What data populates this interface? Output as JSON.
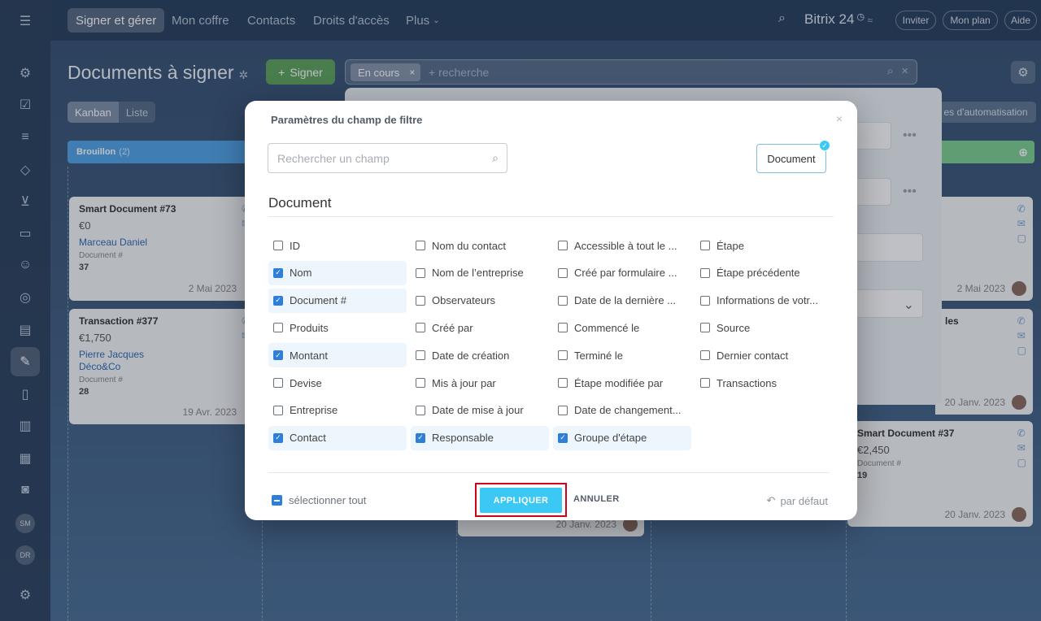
{
  "topbar": {
    "nav": [
      "Signer et gérer",
      "Mon coffre",
      "Contacts",
      "Droits d'accès",
      "Plus"
    ],
    "brand": "Bitrix 24",
    "pills": [
      "Inviter",
      "Mon plan",
      "Aide"
    ]
  },
  "rail": {
    "avatars": [
      "SM",
      "DR"
    ]
  },
  "page": {
    "title": "Documents à signer",
    "sign_button": "Signer",
    "filter_chip": "En cours",
    "filter_placeholder": "+ recherche",
    "view_kanban": "Kanban",
    "view_list": "Liste",
    "automation_label": "es d'automatisation"
  },
  "kanban": {
    "column_draft": "Brouillon",
    "column_draft_count": "(2)",
    "cards": [
      {
        "title": "Smart Document #73",
        "sum": "€0",
        "person": "Marceau Daniel",
        "field": "Document #",
        "value": "37",
        "date": "2 Mai 2023"
      },
      {
        "title": "Transaction #377",
        "sum": "€1,750",
        "person": "Pierre Jacques",
        "company": "Déco&Co",
        "field": "Document #",
        "value": "28",
        "date": "19 Avr. 2023"
      },
      {
        "title": "les",
        "date": "2 Mai 2023"
      },
      {
        "title": "",
        "date": "20 Janv. 2023"
      },
      {
        "title": "Smart Document #37",
        "sum": "€2,450",
        "field": "Document #",
        "value": "19",
        "date": "20 Janv. 2023"
      },
      {
        "date": "20 Janv. 2023"
      }
    ]
  },
  "modal": {
    "title": "Paramètres du champ de filtre",
    "search_placeholder": "Rechercher un champ",
    "tag": "Document",
    "section": "Document",
    "columns": [
      [
        {
          "label": "ID",
          "checked": false
        },
        {
          "label": "Nom",
          "checked": true
        },
        {
          "label": "Document #",
          "checked": true
        },
        {
          "label": "Produits",
          "checked": false
        },
        {
          "label": "Montant",
          "checked": true
        },
        {
          "label": "Devise",
          "checked": false
        },
        {
          "label": "Entreprise",
          "checked": false
        },
        {
          "label": "Contact",
          "checked": true
        }
      ],
      [
        {
          "label": "Nom du contact",
          "checked": false
        },
        {
          "label": "Nom de l’entreprise",
          "checked": false
        },
        {
          "label": "Observateurs",
          "checked": false
        },
        {
          "label": "Créé par",
          "checked": false
        },
        {
          "label": "Date de création",
          "checked": false
        },
        {
          "label": "Mis à jour par",
          "checked": false
        },
        {
          "label": "Date de mise à jour",
          "checked": false
        },
        {
          "label": "Responsable",
          "checked": true
        }
      ],
      [
        {
          "label": "Accessible à tout le ...",
          "checked": false
        },
        {
          "label": "Créé par formulaire ...",
          "checked": false
        },
        {
          "label": "Date de la dernière ...",
          "checked": false
        },
        {
          "label": "Commencé le",
          "checked": false
        },
        {
          "label": "Terminé le",
          "checked": false
        },
        {
          "label": "Étape modifiée par",
          "checked": false
        },
        {
          "label": "Date de changement...",
          "checked": false
        },
        {
          "label": "Groupe d'étape",
          "checked": true
        }
      ],
      [
        {
          "label": "Étape",
          "checked": false
        },
        {
          "label": "Étape précédente",
          "checked": false
        },
        {
          "label": "Informations de votr...",
          "checked": false
        },
        {
          "label": "Source",
          "checked": false
        },
        {
          "label": "Dernier contact",
          "checked": false
        },
        {
          "label": "Transactions",
          "checked": false
        }
      ]
    ],
    "select_all": "sélectionner tout",
    "apply": "APPLIQUER",
    "cancel": "ANNULER",
    "default": "par défaut"
  }
}
